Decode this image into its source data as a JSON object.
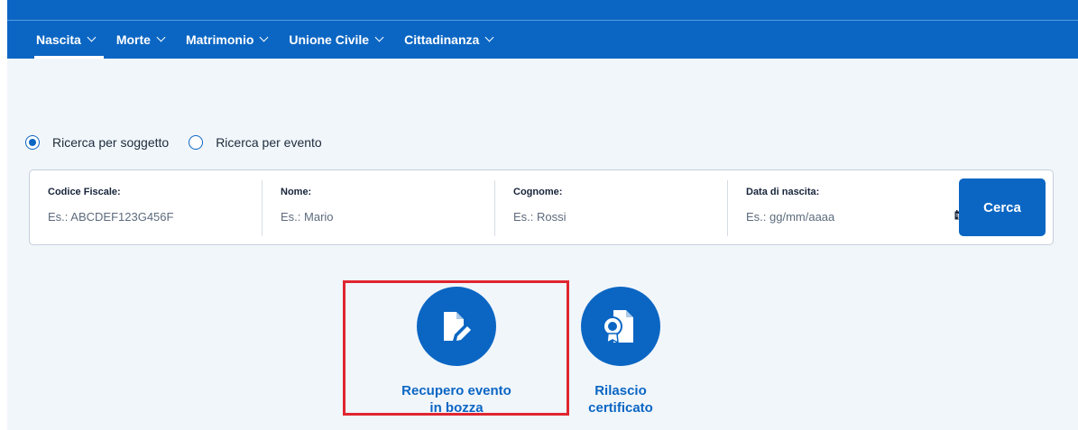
{
  "nav": {
    "items": [
      {
        "label": "Nascita",
        "active": true
      },
      {
        "label": "Morte",
        "active": false
      },
      {
        "label": "Matrimonio",
        "active": false
      },
      {
        "label": "Unione Civile",
        "active": false
      },
      {
        "label": "Cittadinanza",
        "active": false
      }
    ]
  },
  "search": {
    "modes": [
      {
        "label": "Ricerca per soggetto",
        "selected": true
      },
      {
        "label": "Ricerca per evento",
        "selected": false
      }
    ],
    "fields": [
      {
        "label": "Codice Fiscale:",
        "placeholder": "Es.: ABCDEF123G456F"
      },
      {
        "label": "Nome:",
        "placeholder": "Es.: Mario"
      },
      {
        "label": "Cognome:",
        "placeholder": "Es.: Rossi"
      },
      {
        "label": "Data di nascita:",
        "placeholder": "Es.: gg/mm/aaaa"
      }
    ],
    "submit_label": "Cerca"
  },
  "actions": [
    {
      "line1": "Recupero evento",
      "line2": "in bozza",
      "icon": "edit-document-icon"
    },
    {
      "line1": "Rilascio",
      "line2": "certificato",
      "icon": "certificate-document-icon"
    }
  ],
  "colors": {
    "primary": "#0b66c3",
    "background": "#f1f6fb",
    "highlight": "#e0262f"
  }
}
